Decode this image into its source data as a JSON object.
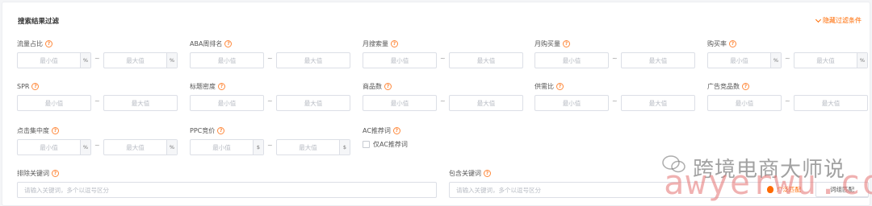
{
  "panel": {
    "title": "搜索结果过滤",
    "toggle_label": "隐藏过滤条件"
  },
  "placeholders": {
    "min": "最小值",
    "max": "最大值"
  },
  "filters": {
    "traffic_share": {
      "label": "流量占比",
      "unit": "%"
    },
    "aba_rank": {
      "label": "ABA周排名"
    },
    "monthly_search": {
      "label": "月搜索量"
    },
    "monthly_purchase": {
      "label": "月购买量"
    },
    "purchase_rate": {
      "label": "购买率",
      "unit": "%"
    },
    "spr": {
      "label": "SPR"
    },
    "title_density": {
      "label": "标题密度"
    },
    "product_count": {
      "label": "商品数"
    },
    "supply_demand": {
      "label": "供需比"
    },
    "ad_products": {
      "label": "广告竞品数"
    },
    "click_concentration": {
      "label": "点击集中度",
      "unit": "%"
    },
    "ppc_bid": {
      "label": "PPC竞价",
      "unit": "$"
    },
    "ac_keyword": {
      "label": "AC推荐词",
      "checkbox_label": "仅AC推荐词"
    }
  },
  "keywords": {
    "exclude": {
      "label": "排除关键词",
      "placeholder": "请输入关键词，多个以逗号区分"
    },
    "include": {
      "label": "包含关键词",
      "placeholder": "请输入关键词，多个以逗号区分"
    },
    "broad_match": "广泛匹配",
    "exact_match": "词组匹配"
  },
  "watermark": {
    "cn": "跨境电商大师说",
    "en": "awyerwu.com"
  },
  "colors": {
    "accent": "#ff6a00",
    "border": "#dcdfe6"
  }
}
